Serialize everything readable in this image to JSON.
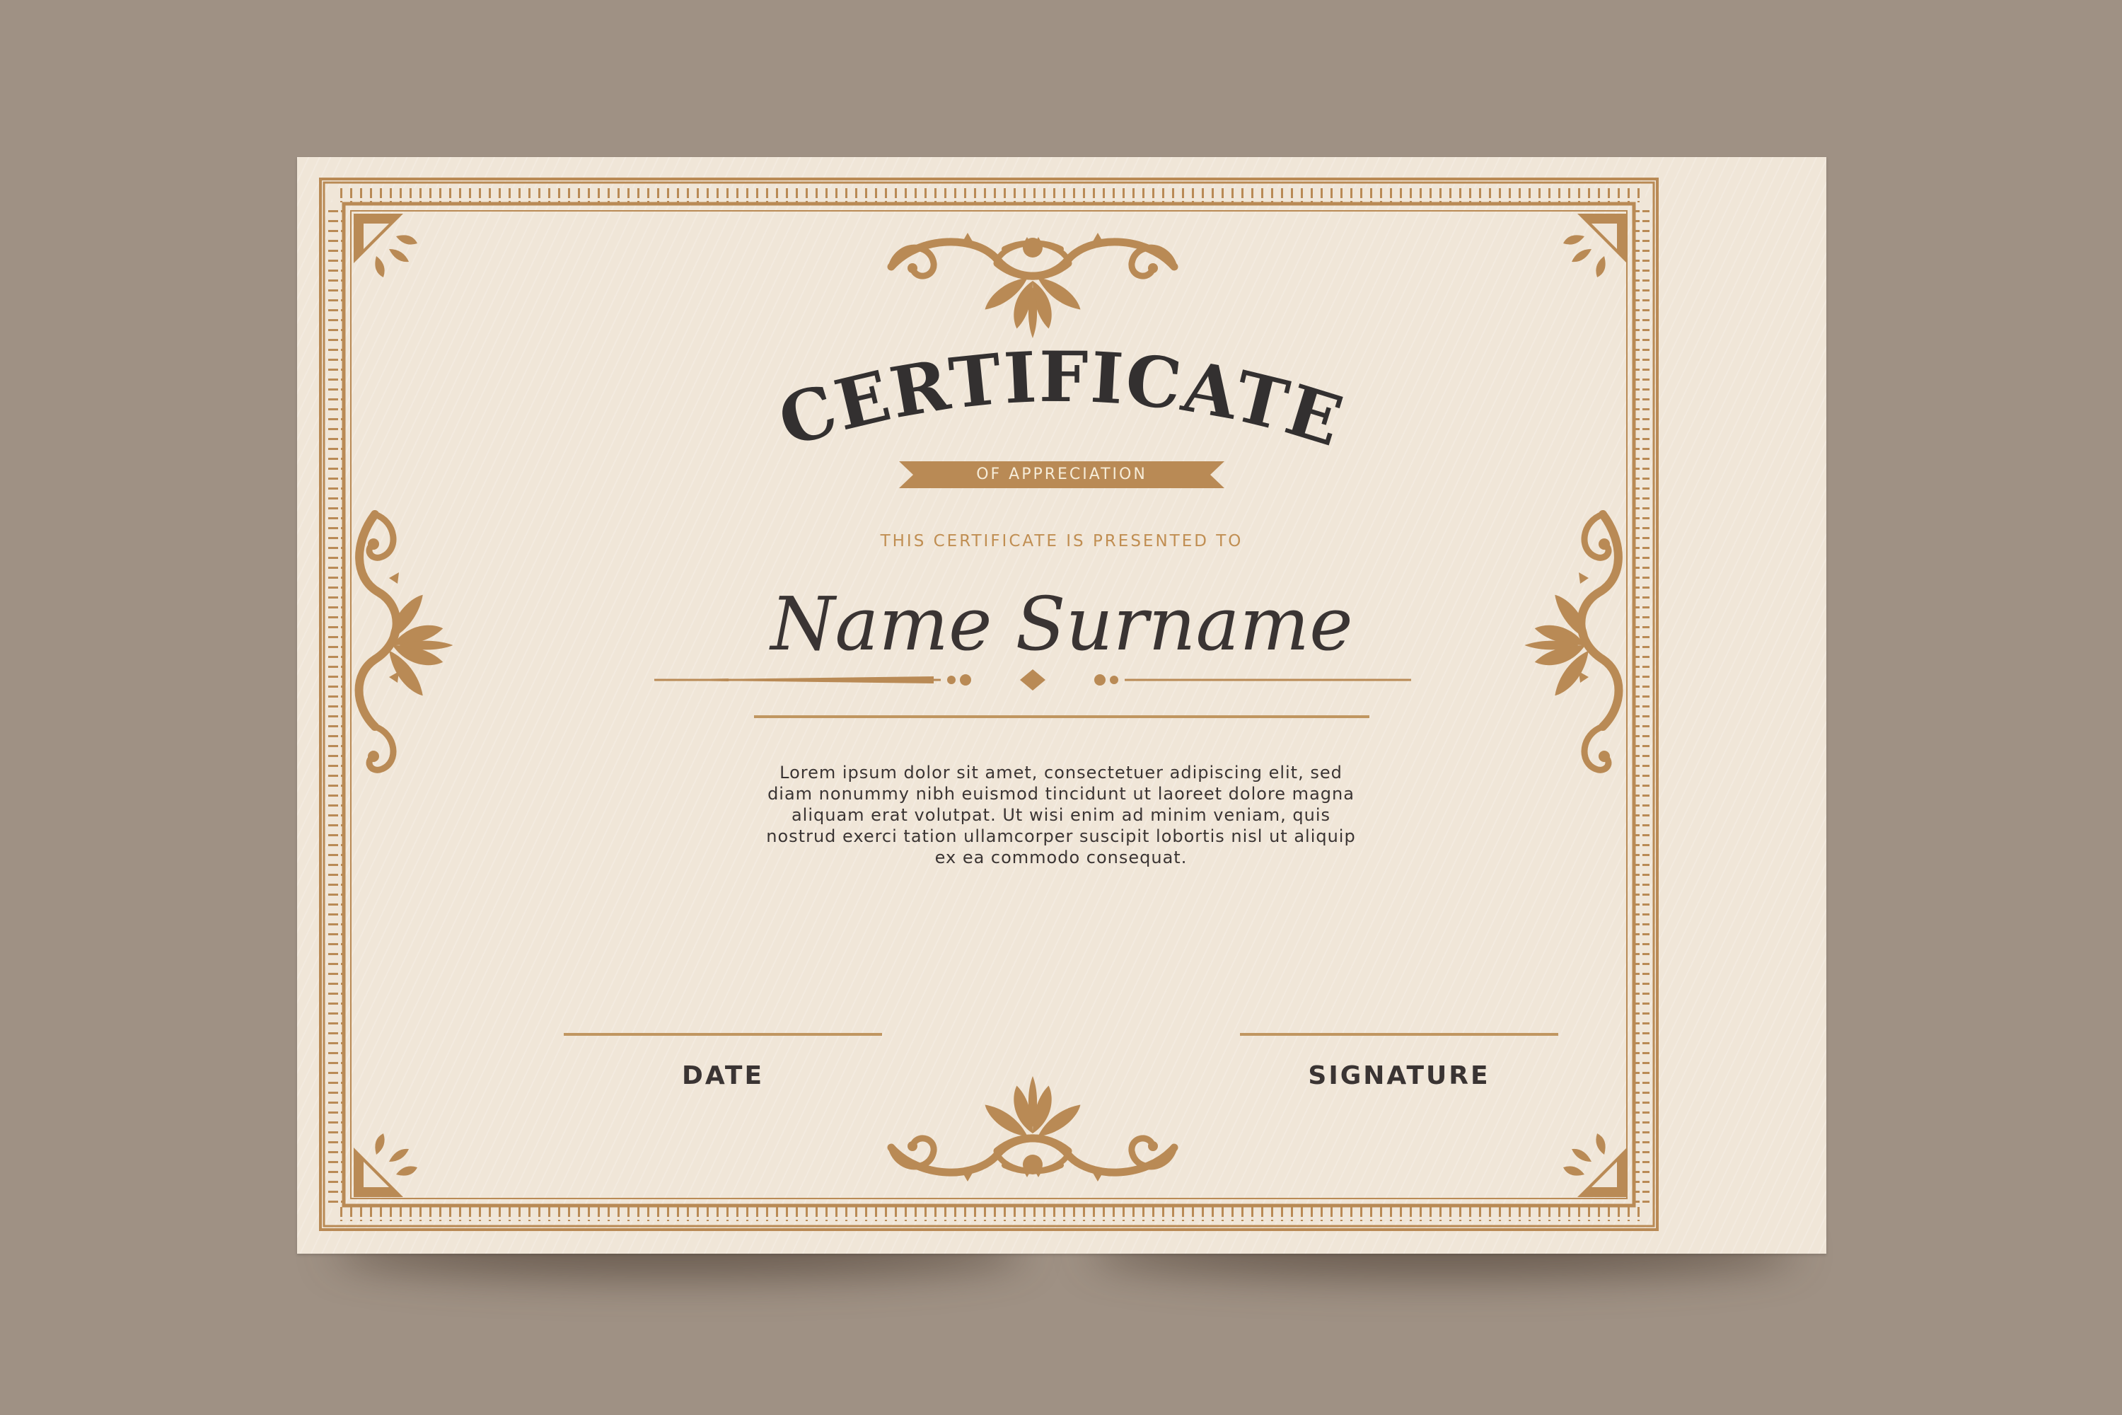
{
  "certificate": {
    "title": "CERTIFICATE",
    "subtitle": "OF APPRECIATION",
    "presented_to": "THIS CERTIFICATE IS PRESENTED TO",
    "recipient_name": "Name Surname",
    "body_lines": [
      "Lorem ipsum dolor sit amet, consectetuer adipiscing elit, sed",
      "diam nonummy nibh euismod tincidunt ut laoreet dolore magna",
      "aliquam erat volutpat. Ut wisi enim ad minim veniam, quis",
      "nostrud exerci tation ullamcorper suscipit lobortis nisl ut aliquip",
      "ex ea commodo consequat."
    ],
    "date_label": "DATE",
    "signature_label": "SIGNATURE"
  },
  "colors": {
    "background": "#9f9184",
    "paper": "#f0e6d8",
    "gold": "#b98a55",
    "text_dark": "#3a3433"
  },
  "icons": [
    "corner-flourish-icon",
    "top-flourish-icon",
    "side-flourish-icon",
    "divider-ornament-icon"
  ]
}
